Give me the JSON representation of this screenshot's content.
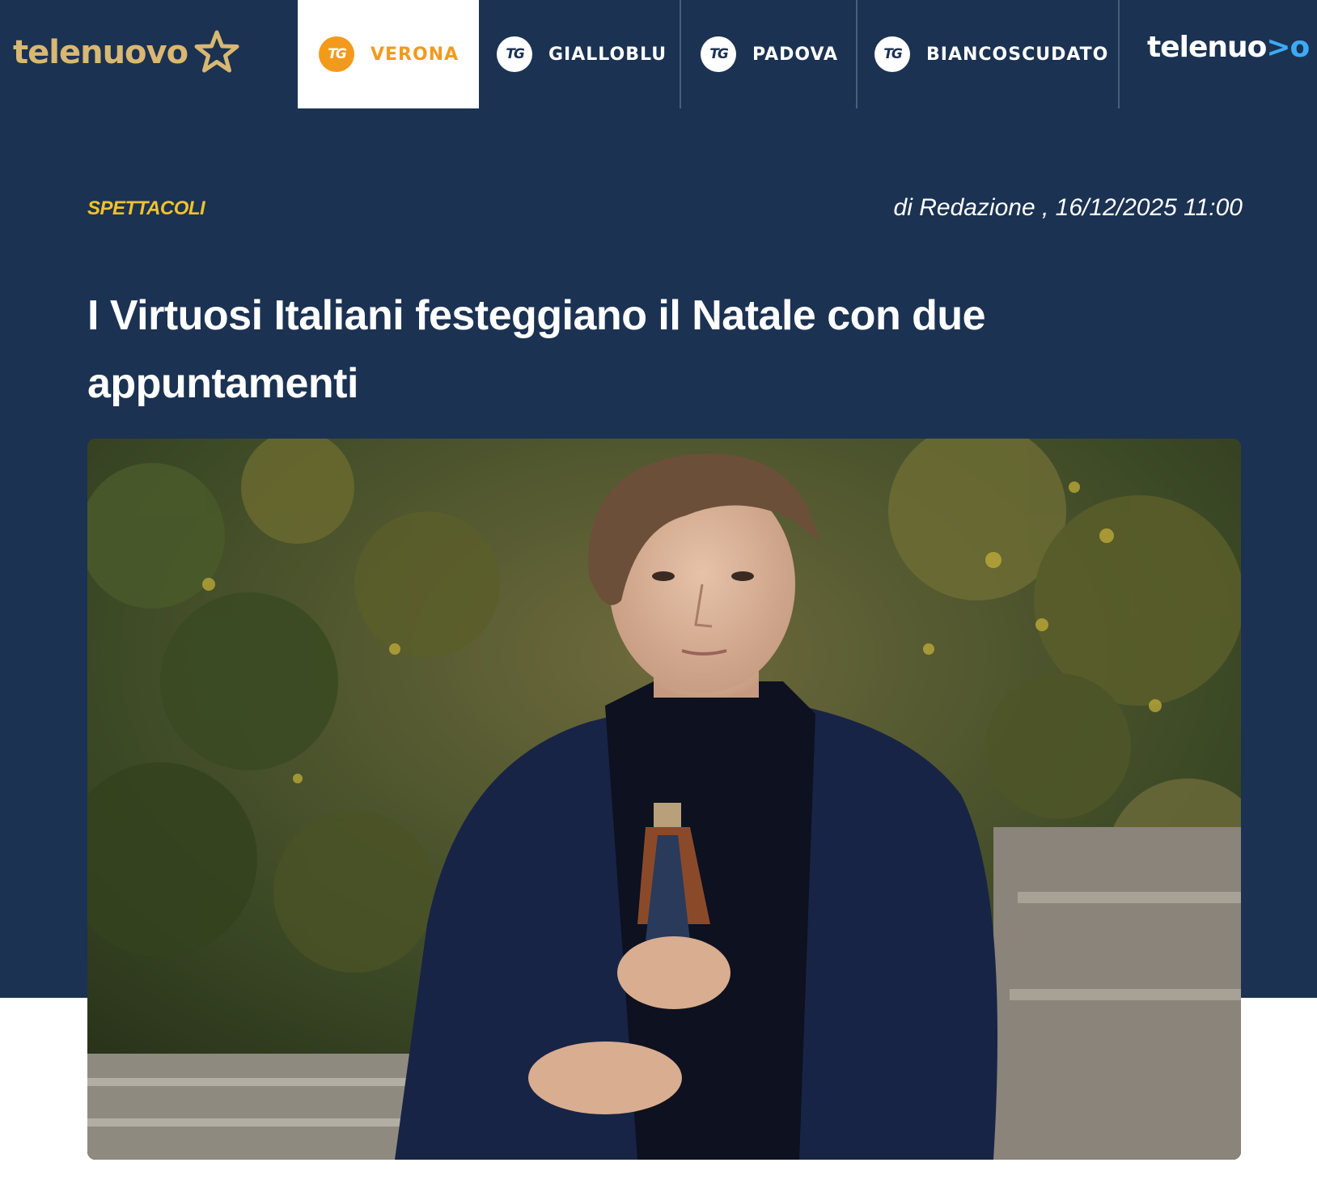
{
  "brand": {
    "logo_text": "telenuovo",
    "logo_icon": "star-icon",
    "right_logo_text": "telenuo",
    "right_logo_accent": ">o"
  },
  "nav": {
    "tabs": [
      {
        "label": "VERONA",
        "icon": "tg-icon",
        "active": true
      },
      {
        "label": "GIALLOBLU",
        "icon": "tg-icon",
        "active": false
      },
      {
        "label": "PADOVA",
        "icon": "tg-icon",
        "active": false
      },
      {
        "label": "BIANCOSCUDATO",
        "icon": "tg-icon",
        "active": false
      }
    ],
    "tg_glyph": "TG"
  },
  "article": {
    "category": "SPETTACOLI",
    "byline": "di Redazione , 16/12/2025 11:00",
    "title": "I Virtuosi Italiani festeggiano il Natale con due appuntamenti"
  },
  "colors": {
    "navy": "#1b3252",
    "brand_gold": "#d8b872",
    "active_orange": "#f39a1d",
    "category_yellow": "#f2c12e",
    "accent_blue": "#3fa9f5"
  }
}
